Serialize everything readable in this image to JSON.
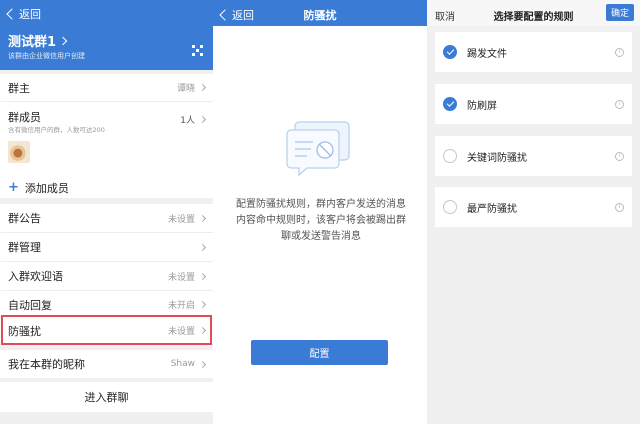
{
  "panel1": {
    "back_label": "返回",
    "group_name": "测试群1",
    "group_sub": "该群由企业微信用户创建",
    "owner": {
      "label": "群主",
      "value": "谭晓"
    },
    "members": {
      "label": "群成员",
      "sub": "含有微信用户的群，人数可达200",
      "value": "1人"
    },
    "add_member": "添加成员",
    "rows": [
      {
        "label": "群公告",
        "value": "未设置"
      },
      {
        "label": "群管理",
        "value": ""
      },
      {
        "label": "入群欢迎语",
        "value": "未设置"
      },
      {
        "label": "自动回复",
        "value": "未开启"
      },
      {
        "label": "防骚扰",
        "value": "未设置"
      },
      {
        "label": "我在本群的昵称",
        "value": "Shaw"
      }
    ],
    "enter_label": "进入群聊",
    "highlight_color": "#e04b5a"
  },
  "panel2": {
    "back_label": "返回",
    "title": "防骚扰",
    "description": "配置防骚扰规则，群内客户发送的消息内容命中规则时，该客户将会被踢出群聊或发送警告消息",
    "config_button": "配置"
  },
  "panel3": {
    "cancel_label": "取消",
    "title": "选择要配置的规则",
    "confirm_label": "确定",
    "rules": [
      {
        "label": "踢发文件",
        "checked": true
      },
      {
        "label": "防刷屏",
        "checked": true
      },
      {
        "label": "关键词防骚扰",
        "checked": false
      },
      {
        "label": "最严防骚扰",
        "checked": false
      }
    ]
  },
  "colors": {
    "accent": "#3a7bd5",
    "highlight": "#e04b5a",
    "background": "#f0f0f0"
  }
}
